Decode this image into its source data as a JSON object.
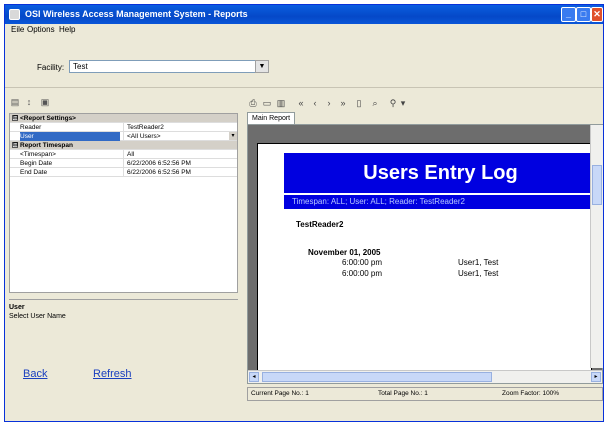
{
  "window": {
    "title": "OSI Wireless Access Management System - Reports"
  },
  "menu": [
    "Eile",
    "Options",
    "Help"
  ],
  "facility": {
    "label": "Facility:",
    "value": "Test"
  },
  "properties": {
    "rows": [
      {
        "type": "category",
        "name": "<Report Settings>",
        "expand": "⊟"
      },
      {
        "type": "prop",
        "name": "Reader",
        "value": "TestReader2"
      },
      {
        "type": "prop",
        "name": "User",
        "value": "<All Users>",
        "selected": true
      },
      {
        "type": "category",
        "name": "Report Timespan",
        "expand": "⊟"
      },
      {
        "type": "prop",
        "name": "<Timespan>",
        "value": "All"
      },
      {
        "type": "prop",
        "name": "Begin Date",
        "value": "6/22/2006 6:52:56 PM"
      },
      {
        "type": "prop",
        "name": "End Date",
        "value": "6/22/2006 6:52:56 PM"
      }
    ],
    "help_title": "User",
    "help_desc": "Select User Name"
  },
  "links": {
    "back": "Back",
    "refresh": "Refresh"
  },
  "report": {
    "tab": "Main Report",
    "title": "Users Entry Log",
    "subtitle": "Timespan: ALL; User: ALL; Reader: TestReader2",
    "reader": "TestReader2",
    "date": "November 01, 2005",
    "entries": [
      {
        "time": "6:00:00 pm",
        "user": "User1, Test"
      },
      {
        "time": "6:00:00 pm",
        "user": "User1, Test"
      }
    ]
  },
  "status": {
    "current_page": "Current Page No.: 1",
    "total_page": "Total Page No.: 1",
    "zoom": "Zoom Factor: 100%"
  }
}
